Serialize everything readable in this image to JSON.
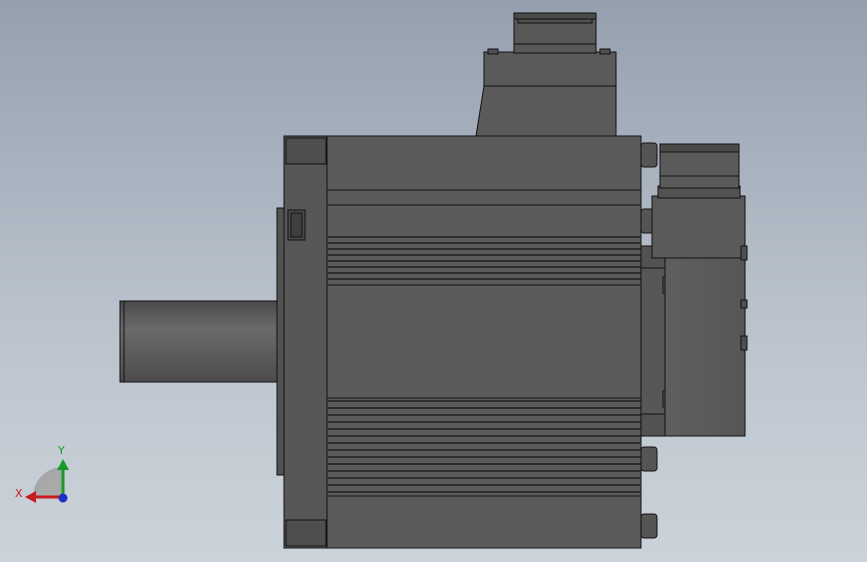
{
  "viewport": {
    "background_top": "#95a0af",
    "background_bottom": "#ccd3da",
    "model_color": "#5b5b5b",
    "edge_color": "#111111"
  },
  "triad": {
    "x_label": "X",
    "y_label": "Y",
    "x_color": "#c81d1d",
    "y_color": "#1a9a2a",
    "z_color": "#1d2fc8"
  }
}
